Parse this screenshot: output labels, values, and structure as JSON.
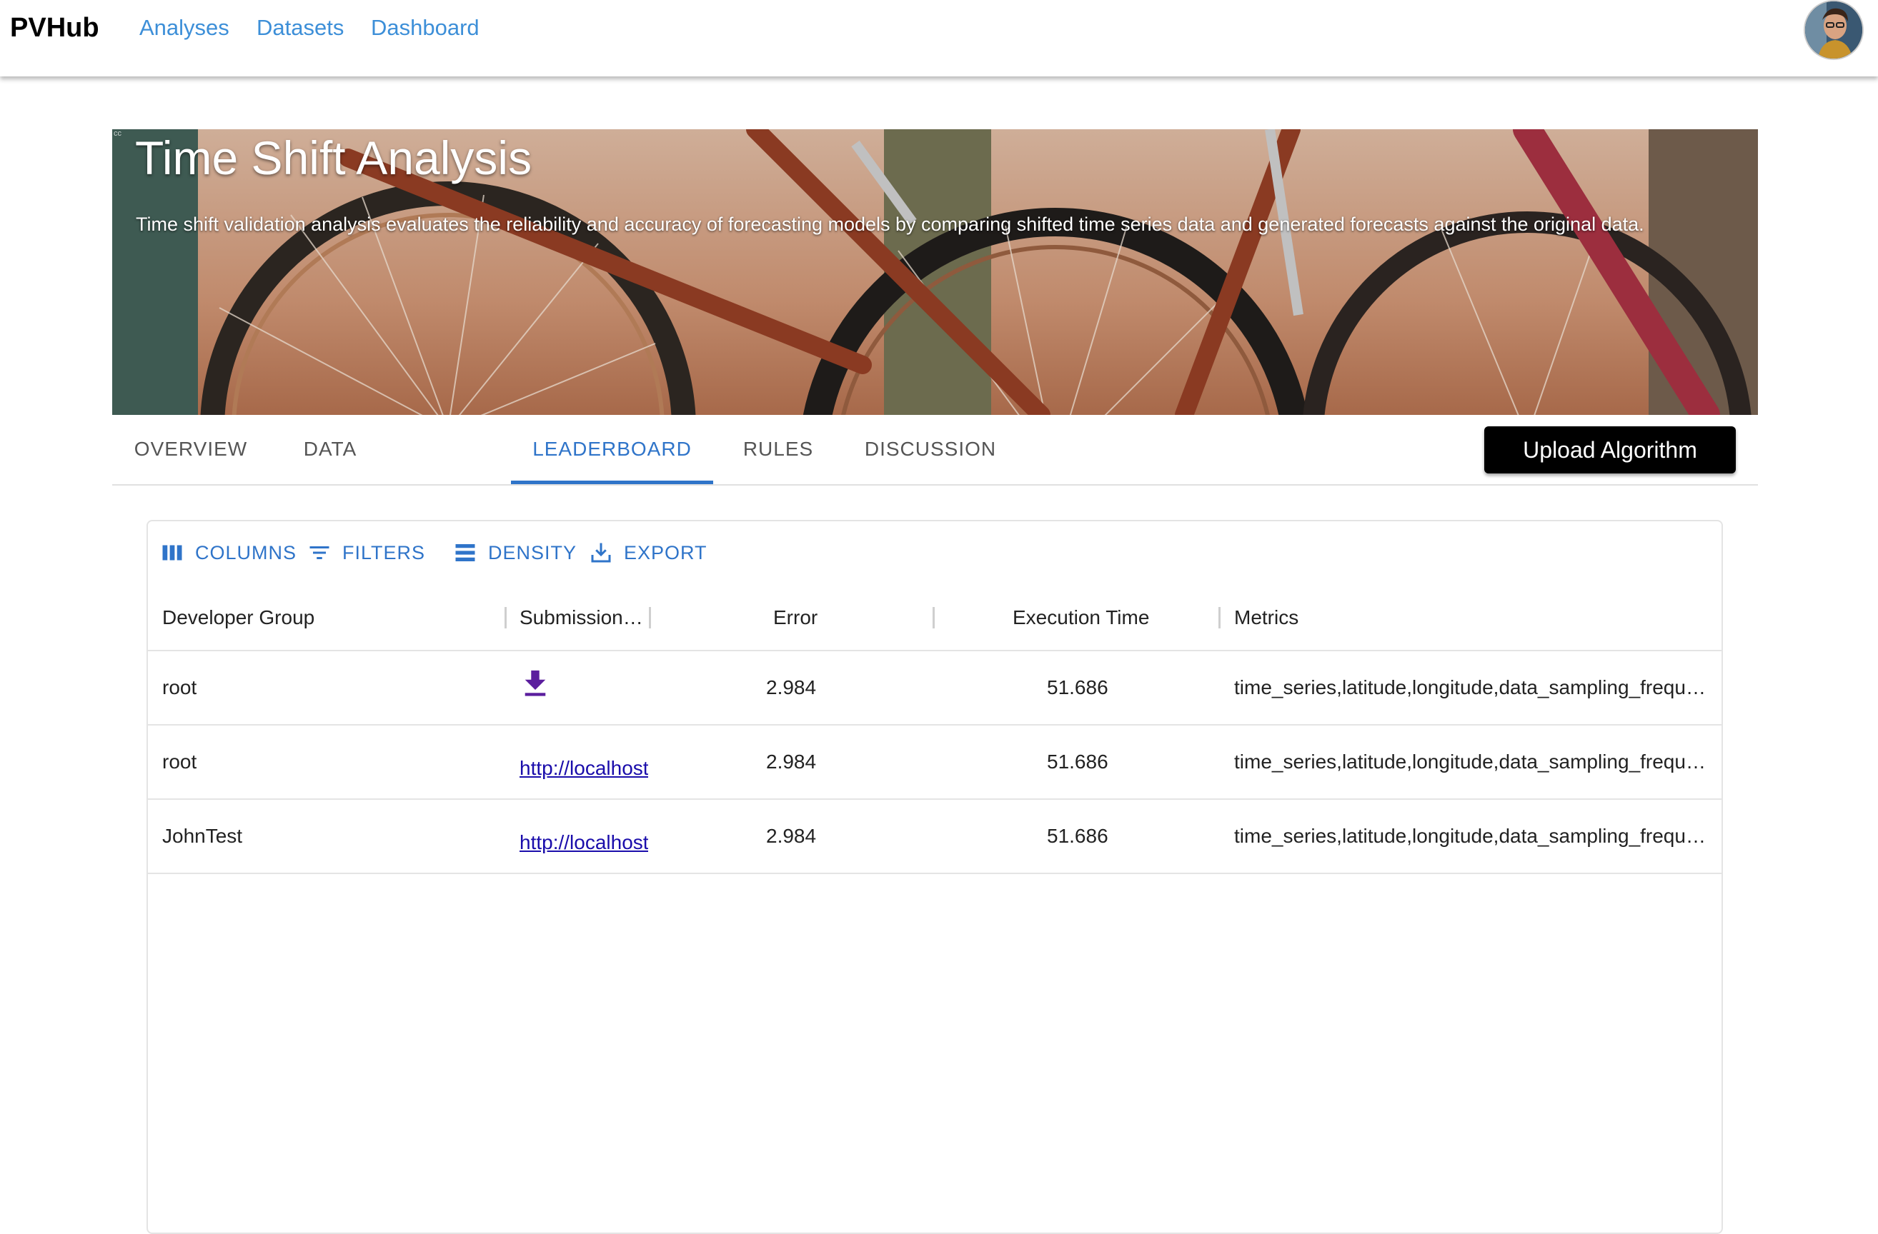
{
  "app": {
    "brand": "PVHub",
    "nav": [
      "Analyses",
      "Datasets",
      "Dashboard"
    ]
  },
  "hero": {
    "title": "Time Shift Analysis",
    "description": "Time shift validation analysis evaluates the reliability and accuracy of forecasting models by comparing shifted time series data and generated forecasts against the original data.",
    "cc_mark": "cc"
  },
  "tabs": {
    "items": [
      "OVERVIEW",
      "DATA",
      "LEADERBOARD",
      "RULES",
      "DISCUSSION"
    ],
    "active": "LEADERBOARD",
    "upload_label": "Upload Algorithm"
  },
  "grid": {
    "toolbar": {
      "columns": "COLUMNS",
      "filters": "FILTERS",
      "density": "DENSITY",
      "export": "EXPORT"
    },
    "headers": {
      "developer_group": "Developer Group",
      "submission": "Submission…",
      "error": "Error",
      "execution_time": "Execution Time",
      "metrics": "Metrics"
    },
    "rows": [
      {
        "developer_group": "root",
        "submission": "download-icon",
        "error": "2.984",
        "execution_time": "51.686",
        "metrics": "time_series,latitude,longitude,data_sampling_frequ…"
      },
      {
        "developer_group": "root",
        "submission": "http://localhost",
        "error": "2.984",
        "execution_time": "51.686",
        "metrics": "time_series,latitude,longitude,data_sampling_frequ…"
      },
      {
        "developer_group": "JohnTest",
        "submission": "http://localhost",
        "error": "2.984",
        "execution_time": "51.686",
        "metrics": "time_series,latitude,longitude,data_sampling_frequ…"
      }
    ]
  },
  "colors": {
    "accent": "#2f74c9",
    "nav_link": "#3d8fd8",
    "download_icon": "#5b1e9e",
    "link": "#1a0dab"
  }
}
